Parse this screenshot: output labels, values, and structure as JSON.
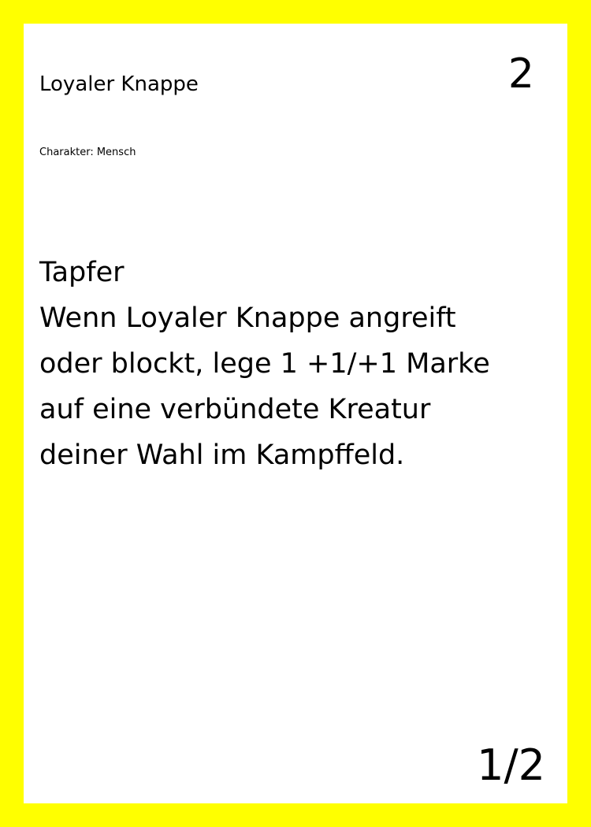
{
  "card": {
    "name": "Loyaler Knappe",
    "cost": "2",
    "type_line": "Charakter: Mensch",
    "rules_lines": [
      "Tapfer",
      "Wenn Loyaler Knappe angreift",
      "oder blockt, lege 1 +1/+1 Marke",
      "auf eine verbündete Kreatur",
      "deiner Wahl im Kampffeld."
    ],
    "stats": "1/2"
  },
  "colors": {
    "border": "#ffff00",
    "card_background": "#ffffff",
    "text": "#000000"
  }
}
